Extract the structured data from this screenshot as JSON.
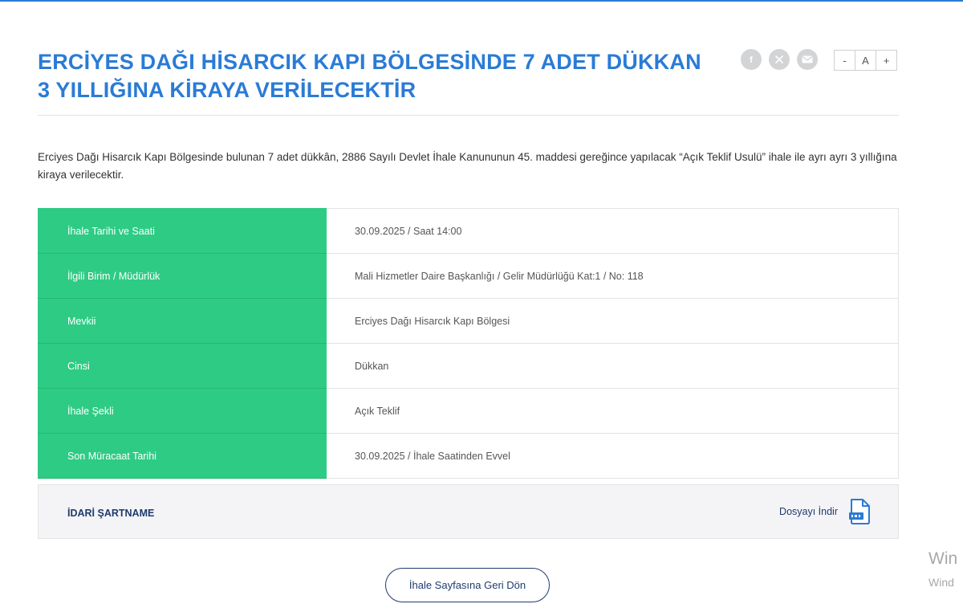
{
  "page": {
    "title": "ERCİYES DAĞI HİSARCIK KAPI BÖLGESİNDE 7 ADET DÜKKAN 3 YILLIĞINA KİRAYA VERİLECEKTİR",
    "description": "Erciyes Dağı Hisarcık Kapı Bölgesinde bulunan 7 adet dükkân, 2886 Sayılı Devlet İhale Kanununun 45. maddesi gereğince yapılacak “Açık Teklif Usulü” ihale ile ayrı ayrı 3 yıllığına kiraya verilecektir.",
    "accent_color": "#2a7bd6",
    "label_color": "#2ecb84"
  },
  "share": {
    "icons": [
      "facebook-icon",
      "x-icon",
      "mail-icon"
    ]
  },
  "font_controls": {
    "decrease": "-",
    "reset": "A",
    "increase": "+"
  },
  "details": [
    {
      "label": "İhale Tarihi ve Saati",
      "value": "30.09.2025 / Saat 14:00"
    },
    {
      "label": "İlgili Birim / Müdürlük",
      "value": "Mali Hizmetler Daire Başkanlığı / Gelir Müdürlüğü Kat:1 / No: 118"
    },
    {
      "label": "Mevkii",
      "value": "Erciyes Dağı Hisarcık Kapı Bölgesi"
    },
    {
      "label": "Cinsi",
      "value": "Dükkan"
    },
    {
      "label": "İhale Şekli",
      "value": "Açık Teklif"
    },
    {
      "label": "Son Müracaat Tarihi",
      "value": "30.09.2025 / İhale Saatinden Evvel"
    }
  ],
  "document": {
    "title": "İDARİ ŞARTNAME",
    "download_label": "Dosyayı İndir",
    "icon": "pdf-file-icon"
  },
  "back_button": {
    "label": "İhale Sayfasına Geri Dön"
  },
  "watermark": {
    "line1": "Win",
    "line2": "Wind"
  }
}
